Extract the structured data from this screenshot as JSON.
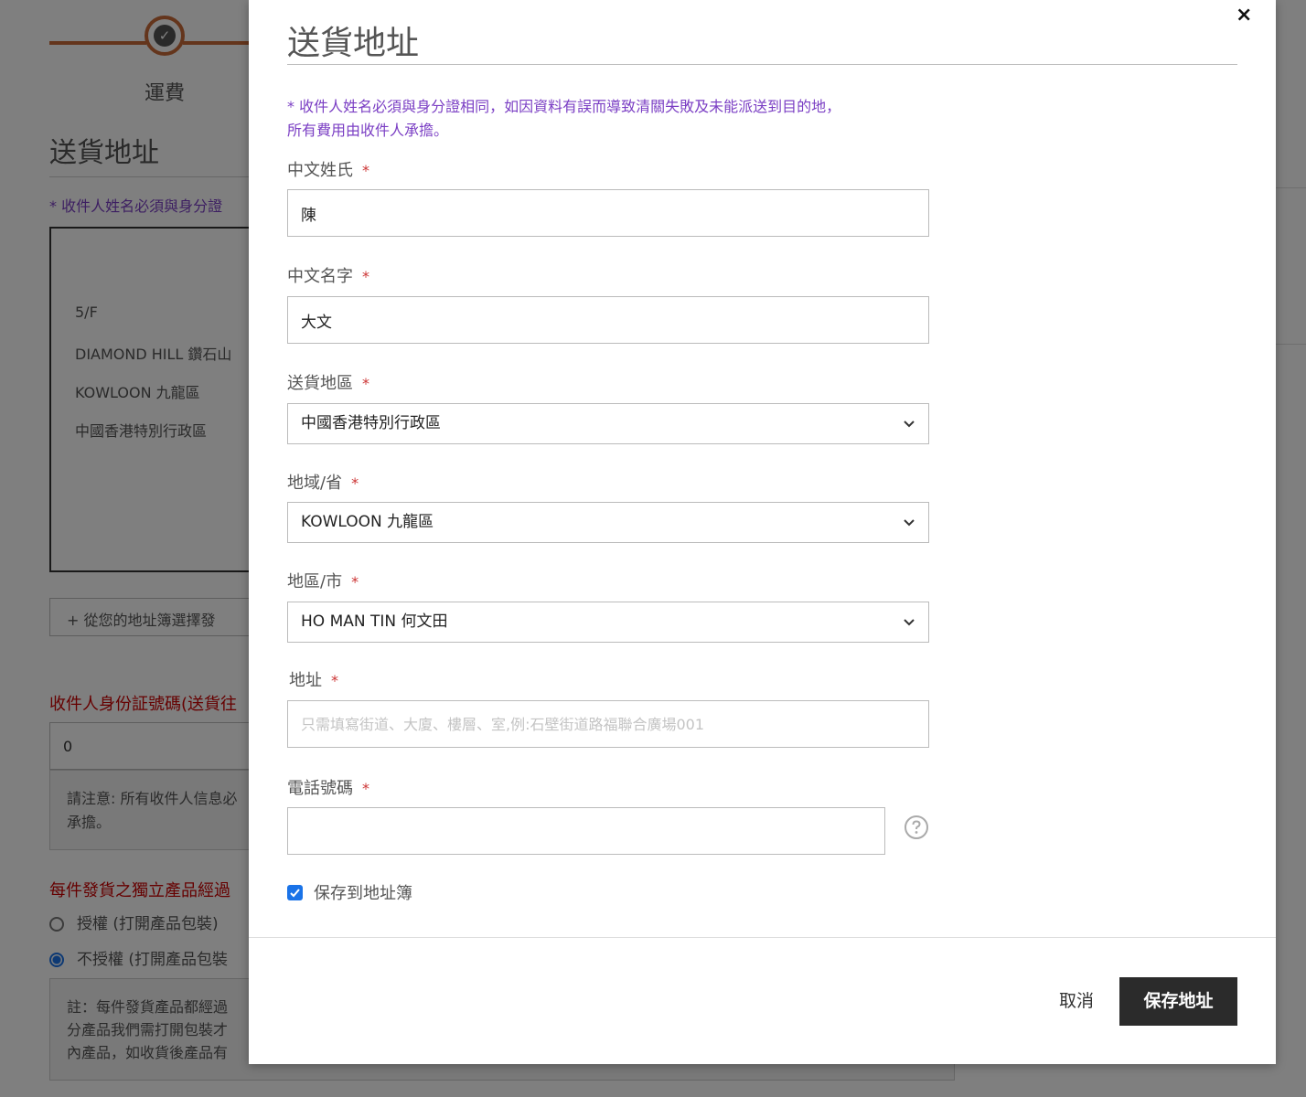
{
  "background": {
    "step_label": "運費",
    "title": "送貨地址",
    "note": "* 收件人姓名必須與身分證",
    "address_lines": [
      "5/F",
      "DIAMOND HILL 鑽石山",
      "KOWLOON 九龍區",
      "中國香港特別行政區"
    ],
    "address_book_link": "+ 從您的地址簿選擇發",
    "id_label": "收件人身份証號碼(送貨往",
    "id_value": "0",
    "info_text": "請注意: 所有收件人信息必",
    "info_text_2": "承擔。",
    "package_label": "每件發貨之獨立產品經過",
    "radio_authorize": "授權 (打開產品包裝)",
    "radio_not_authorize": "不授權 (打開產品包裝",
    "note_box_lines": [
      "註：每件發貨產品都經過",
      "分產品我們需打開包裝才",
      "內產品，如收貨後產品有"
    ]
  },
  "modal": {
    "close": "×",
    "title": "送貨地址",
    "note_line1": "* 收件人姓名必須與身分證相同，如因資料有誤而導致清關失敗及未能派送到目的地，",
    "note_line2": "所有費用由收件人承擔。",
    "required_mark": "*",
    "fields": {
      "surname_label": "中文姓氏",
      "surname_value": "陳",
      "given_name_label": "中文名字",
      "given_name_value": "大文",
      "region_label": "送貨地區",
      "region_value": "中國香港特別行政區",
      "province_label": "地域/省",
      "province_value": "KOWLOON 九龍區",
      "district_label": "地區/市",
      "district_value": "HO MAN TIN 何文田",
      "address_label": "地址",
      "address_placeholder": "只需填寫街道、大廈、樓層、室,例:石壁街道路福聯合廣場001",
      "phone_label": "電話號碼",
      "phone_value": ""
    },
    "save_to_addressbook": "保存到地址簿",
    "cancel": "取消",
    "save": "保存地址"
  },
  "colors": {
    "accent_orange": "#c96a39",
    "note_purple": "#7b3fc4",
    "required_red": "#c33333",
    "checkbox_blue": "#1a73e8",
    "save_button": "#2b2b2b"
  }
}
